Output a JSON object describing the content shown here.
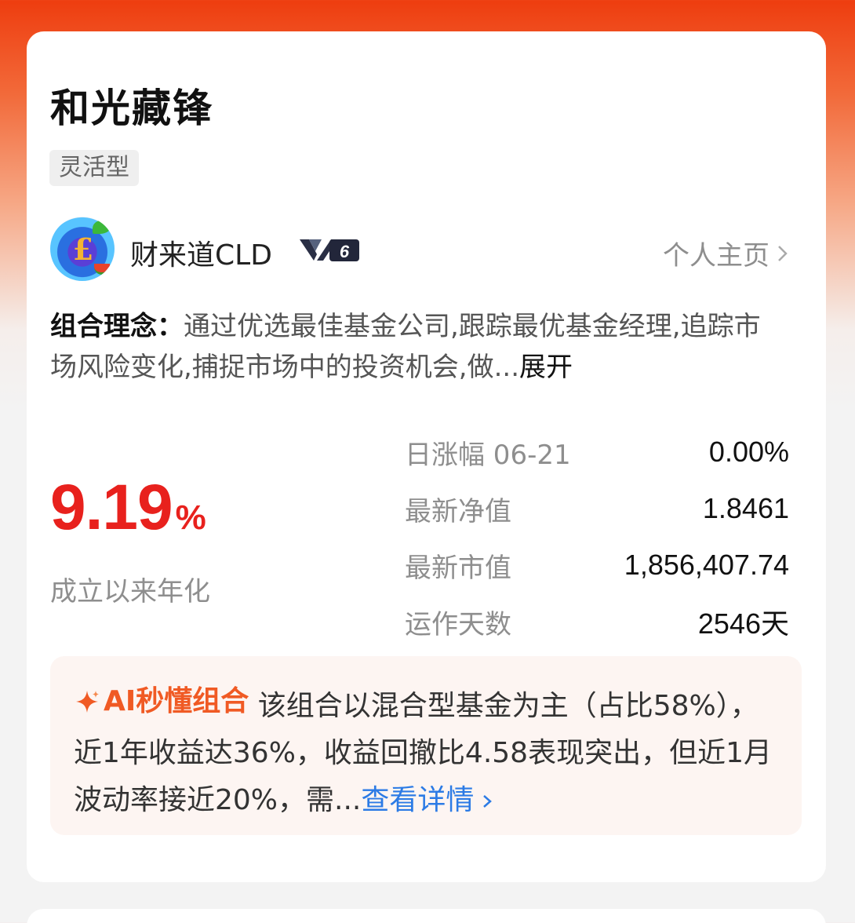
{
  "portfolio": {
    "title": "和光藏锋",
    "tag": "灵活型"
  },
  "manager": {
    "name": "财来道CLD",
    "level": "6",
    "homepage_label": "个人主页"
  },
  "philosophy": {
    "label": "组合理念：",
    "text": "通过优选最佳基金公司,跟踪最优基金经理,追踪市场风险变化,捕捉市场中的投资机会,做...",
    "expand_label": "展开"
  },
  "performance": {
    "annualized_value": "9.19",
    "annualized_unit": "%",
    "annualized_label": "成立以来年化"
  },
  "stats": [
    {
      "label": "日涨幅 06-21",
      "value": "0.00%"
    },
    {
      "label": "最新净值",
      "value": "1.8461"
    },
    {
      "label": "最新市值",
      "value": "1,856,407.74"
    },
    {
      "label": "运作天数",
      "value": "2546天"
    }
  ],
  "ai_summary": {
    "title": "AI秒懂组合",
    "text": "该组合以混合型基金为主（占比58%），近1年收益达36%，收益回撤比4.58表现突出，但近1月波动率接近20%，需...",
    "detail_label": "查看详情"
  },
  "colors": {
    "accent_red": "#e8211d",
    "ai_orange": "#f05a24",
    "link_blue": "#2c7be5"
  }
}
